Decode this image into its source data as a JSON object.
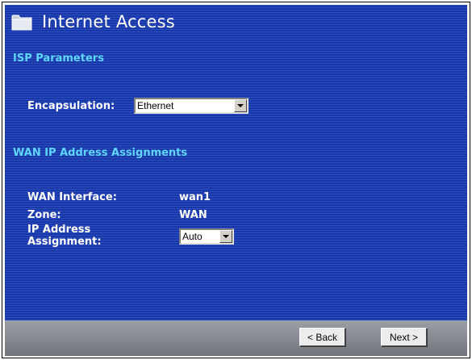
{
  "header": {
    "title": "Internet Access",
    "icon": "folder-icon"
  },
  "isp": {
    "heading": "ISP Parameters",
    "encapsulation_label": "Encapsulation:",
    "encapsulation_value": "Ethernet"
  },
  "wan": {
    "heading": "WAN IP Address Assignments",
    "interface_label": "WAN Interface:",
    "interface_value": "wan1",
    "zone_label": "Zone:",
    "zone_value": "WAN",
    "ip_label_line1": "IP Address",
    "ip_label_line2": "Assignment:",
    "ip_value": "Auto"
  },
  "footer": {
    "back_label": "< Back",
    "next_label": "Next >"
  },
  "colors": {
    "panel": "#1e3fb0",
    "heading": "#5fd6ff",
    "text": "#ffffff"
  }
}
